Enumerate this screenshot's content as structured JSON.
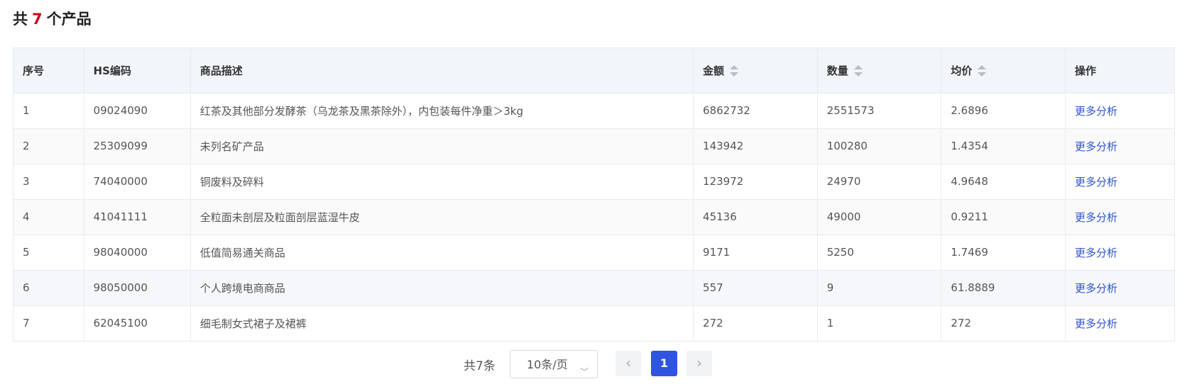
{
  "heading": {
    "prefix": "共",
    "count": "7",
    "suffix": "个产品"
  },
  "table": {
    "columns": [
      {
        "key": "index",
        "label": "序号",
        "sortable": false
      },
      {
        "key": "hs",
        "label": "HS编码",
        "sortable": false
      },
      {
        "key": "desc",
        "label": "商品描述",
        "sortable": false
      },
      {
        "key": "amount",
        "label": "金额",
        "sortable": true
      },
      {
        "key": "qty",
        "label": "数量",
        "sortable": true
      },
      {
        "key": "avg",
        "label": "均价",
        "sortable": true
      },
      {
        "key": "action",
        "label": "操作",
        "sortable": false
      }
    ],
    "rows": [
      {
        "index": "1",
        "hs": "09024090",
        "desc": "红茶及其他部分发酵茶（乌龙茶及黑茶除外），内包装每件净重＞3kg",
        "amount": "6862732",
        "qty": "2551573",
        "avg": "2.6896",
        "action": "更多分析"
      },
      {
        "index": "2",
        "hs": "25309099",
        "desc": "未列名矿产品",
        "amount": "143942",
        "qty": "100280",
        "avg": "1.4354",
        "action": "更多分析"
      },
      {
        "index": "3",
        "hs": "74040000",
        "desc": "铜废料及碎料",
        "amount": "123972",
        "qty": "24970",
        "avg": "4.9648",
        "action": "更多分析"
      },
      {
        "index": "4",
        "hs": "41041111",
        "desc": "全粒面未剖层及粒面剖层蓝湿牛皮",
        "amount": "45136",
        "qty": "49000",
        "avg": "0.9211",
        "action": "更多分析"
      },
      {
        "index": "5",
        "hs": "98040000",
        "desc": "低值简易通关商品",
        "amount": "9171",
        "qty": "5250",
        "avg": "1.7469",
        "action": "更多分析"
      },
      {
        "index": "6",
        "hs": "98050000",
        "desc": "个人跨境电商商品",
        "amount": "557",
        "qty": "9",
        "avg": "61.8889",
        "action": "更多分析"
      },
      {
        "index": "7",
        "hs": "62045100",
        "desc": "细毛制女式裙子及裙裤",
        "amount": "272",
        "qty": "1",
        "avg": "272",
        "action": "更多分析"
      }
    ]
  },
  "pagination": {
    "total_text": "共7条",
    "page_size": "10条/页",
    "current_page": "1",
    "prev_icon": "chevron-left-icon",
    "next_icon": "chevron-right-icon"
  },
  "colors": {
    "accent": "#2f54e0",
    "link": "#2f54c8",
    "count": "#d0021b"
  }
}
